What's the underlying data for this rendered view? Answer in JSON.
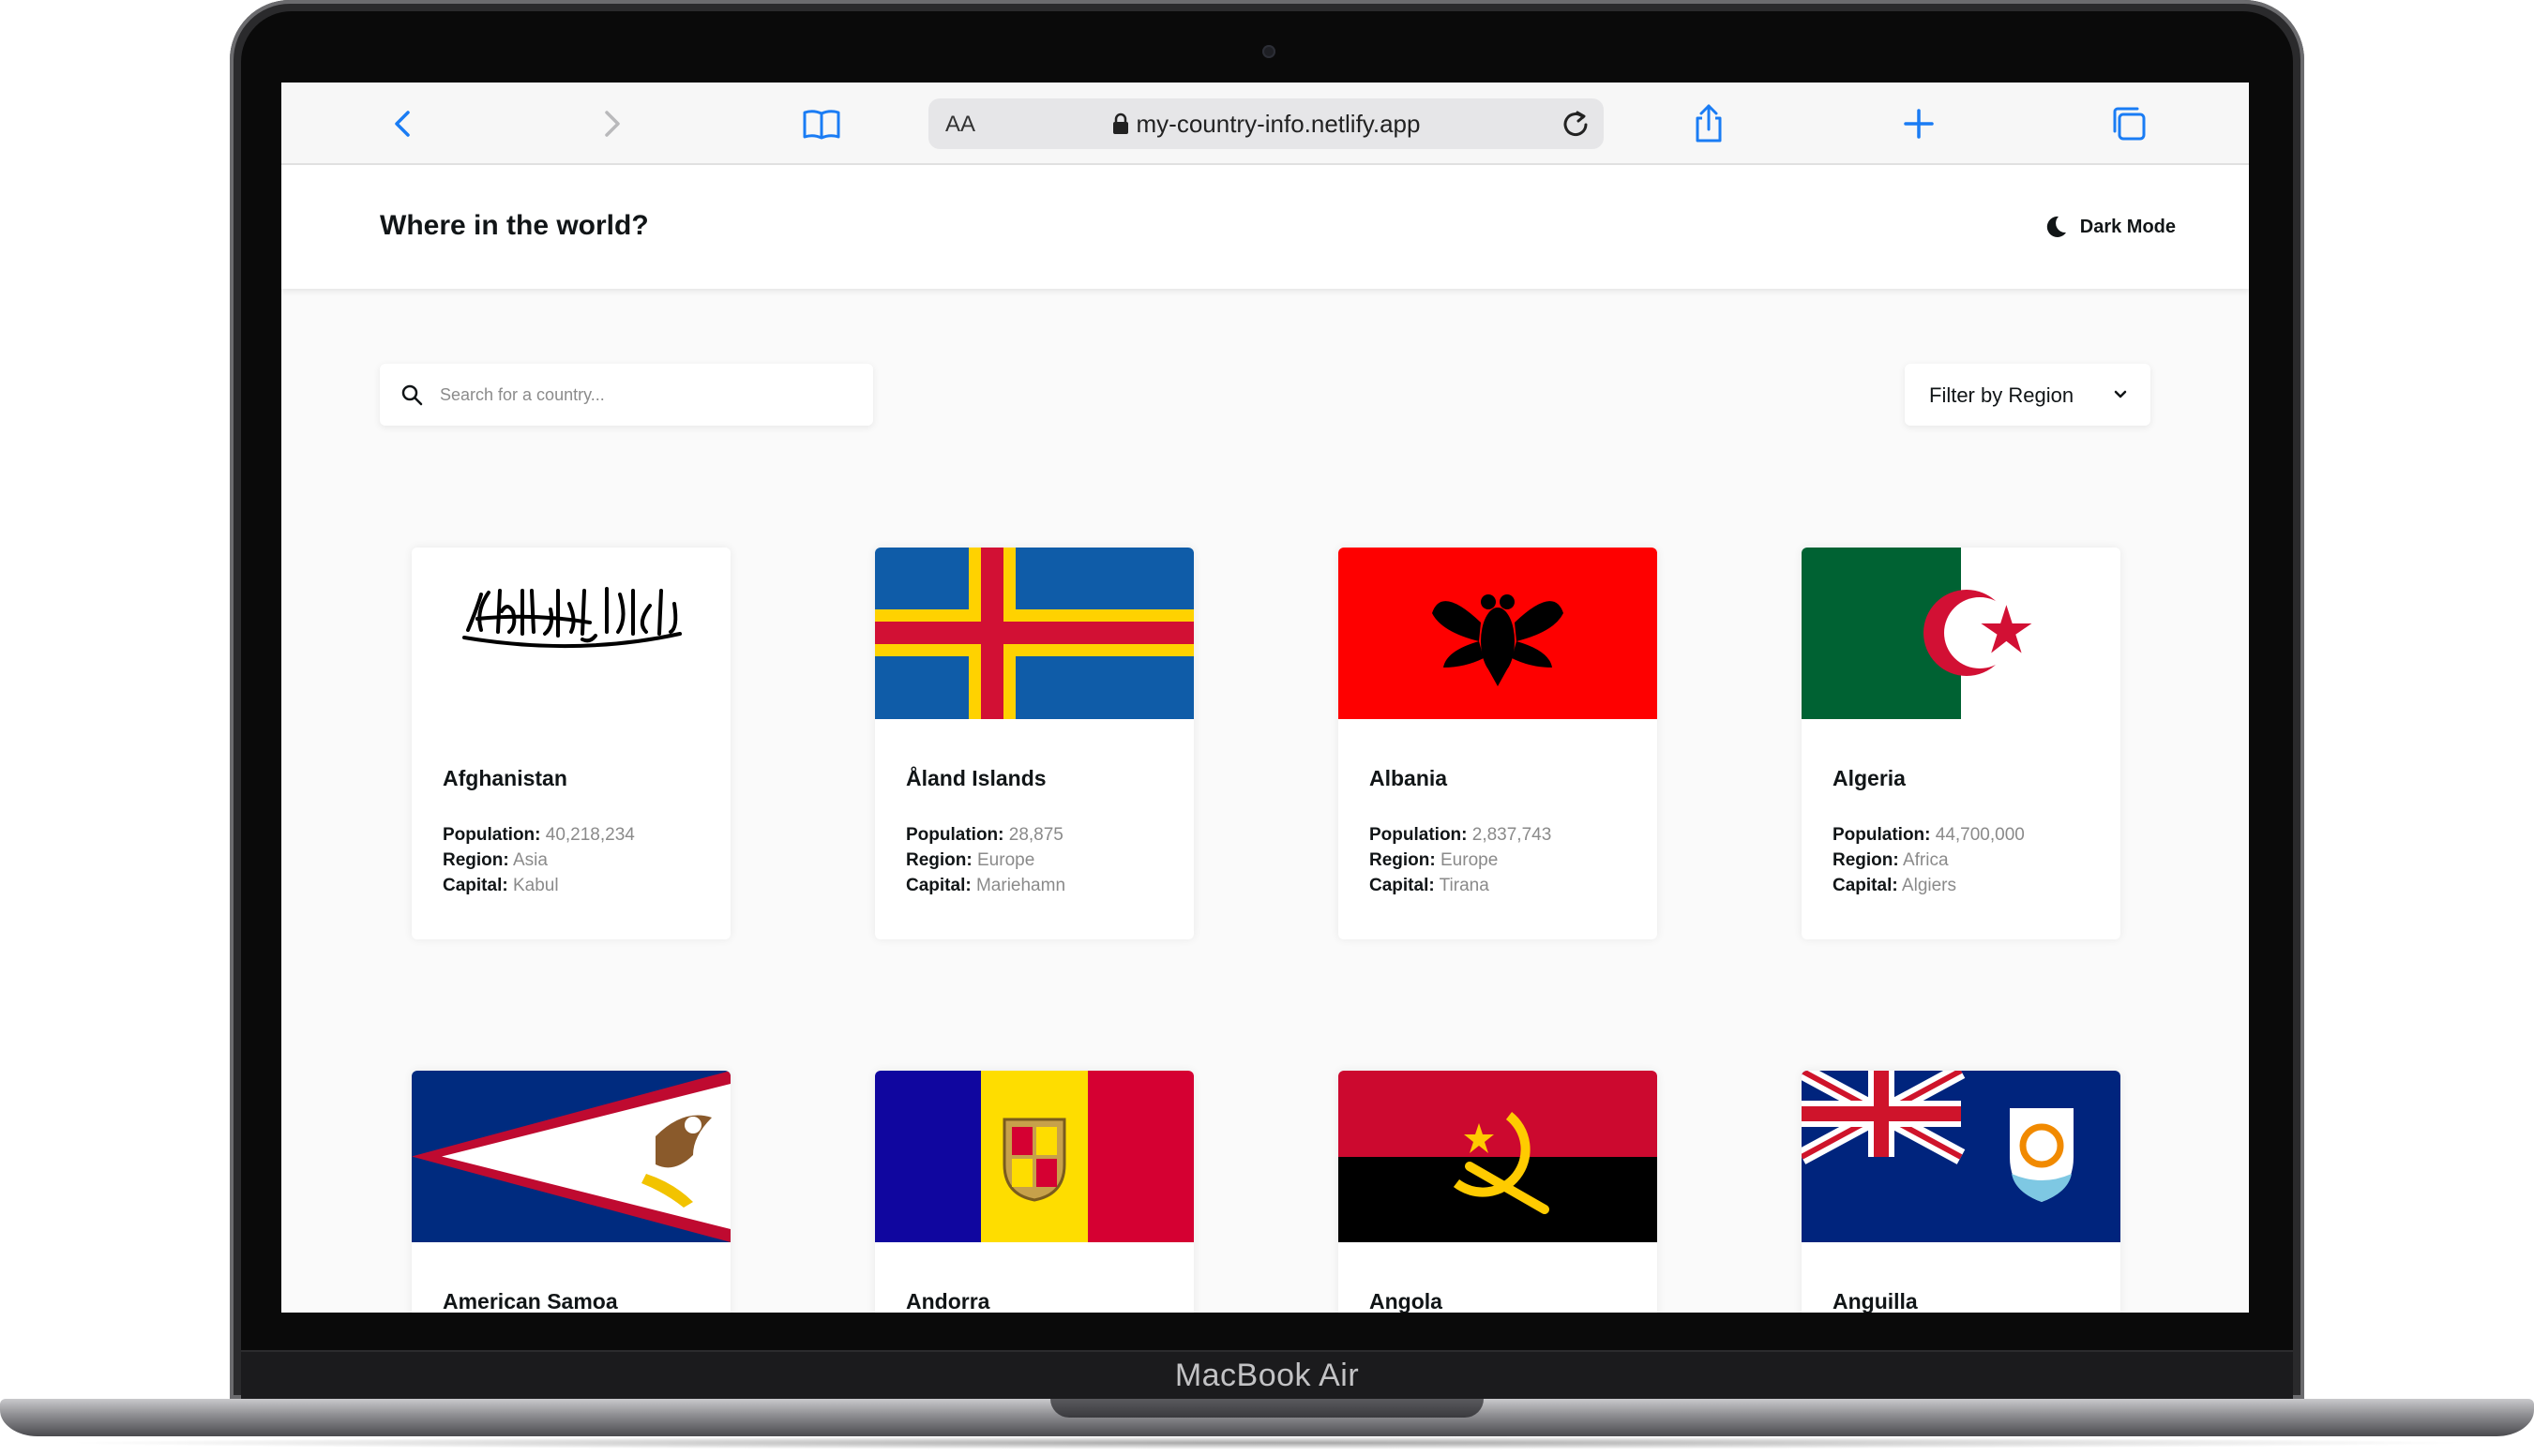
{
  "device": {
    "brand": "MacBook Air"
  },
  "browser": {
    "reader_label": "AA",
    "url": "my-country-info.netlify.app"
  },
  "header": {
    "title": "Where in the world?",
    "dark_mode_label": "Dark Mode"
  },
  "search": {
    "placeholder": "Search for a country..."
  },
  "filter": {
    "label": "Filter by Region"
  },
  "field_labels": {
    "population": "Population:",
    "region": "Region:",
    "capital": "Capital:"
  },
  "countries": [
    {
      "name": "Afghanistan",
      "population": "40,218,234",
      "region": "Asia",
      "capital": "Kabul"
    },
    {
      "name": "Åland Islands",
      "population": "28,875",
      "region": "Europe",
      "capital": "Mariehamn"
    },
    {
      "name": "Albania",
      "population": "2,837,743",
      "region": "Europe",
      "capital": "Tirana"
    },
    {
      "name": "Algeria",
      "population": "44,700,000",
      "region": "Africa",
      "capital": "Algiers"
    },
    {
      "name": "American Samoa"
    },
    {
      "name": "Andorra"
    },
    {
      "name": "Angola"
    },
    {
      "name": "Anguilla"
    }
  ],
  "colors": {
    "accent_blue": "#1a7cf4",
    "text_dark": "#111517",
    "page_bg": "#fafafa"
  }
}
